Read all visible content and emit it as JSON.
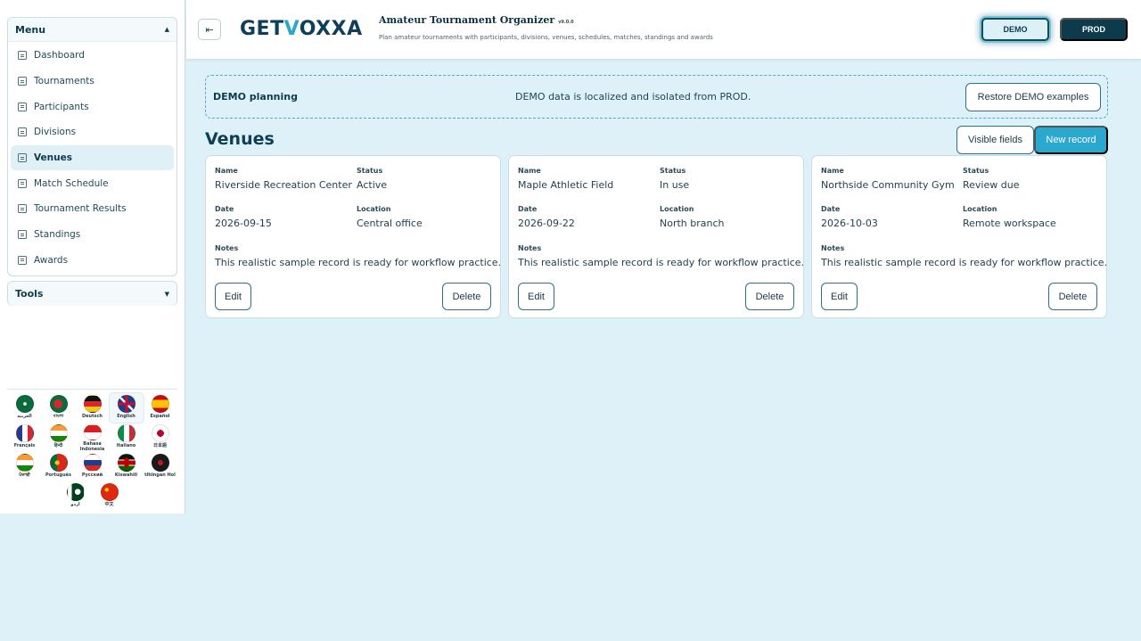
{
  "sidebar": {
    "menu_title": "Menu",
    "tools_title": "Tools",
    "items": [
      {
        "label": "Dashboard"
      },
      {
        "label": "Tournaments"
      },
      {
        "label": "Participants"
      },
      {
        "label": "Divisions"
      },
      {
        "label": "Venues",
        "active": true
      },
      {
        "label": "Match Schedule"
      },
      {
        "label": "Tournament Results"
      },
      {
        "label": "Standings"
      },
      {
        "label": "Awards"
      }
    ],
    "languages": [
      {
        "label": "العربية",
        "flag": "saudi-arabia-flag-icon"
      },
      {
        "label": "বাংলা",
        "flag": "bangladesh-flag-icon"
      },
      {
        "label": "Deutsch",
        "flag": "germany-flag-icon"
      },
      {
        "label": "English",
        "flag": "uk-flag-icon",
        "active": true
      },
      {
        "label": "Español",
        "flag": "spain-flag-icon"
      },
      {
        "label": "Français",
        "flag": "france-flag-icon"
      },
      {
        "label": "हिन्दी",
        "flag": "india-flag-icon"
      },
      {
        "label": "Bahasa Indonesia",
        "flag": "indonesia-flag-icon"
      },
      {
        "label": "Italiano",
        "flag": "italy-flag-icon"
      },
      {
        "label": "日本語",
        "flag": "japan-flag-icon"
      },
      {
        "label": "ਪੰਜਾਬੀ",
        "flag": "india-flag-icon"
      },
      {
        "label": "Português",
        "flag": "portugal-flag-icon"
      },
      {
        "label": "Русский",
        "flag": "russia-flag-icon"
      },
      {
        "label": "Kiswahili",
        "flag": "kenya-flag-icon"
      },
      {
        "label": "tlhIngan Hol",
        "flag": "klingon-flag-icon"
      },
      {
        "label": "اردو",
        "flag": "pakistan-flag-icon"
      },
      {
        "label": "中文",
        "flag": "china-flag-icon"
      }
    ]
  },
  "header": {
    "logo_left": "GET",
    "logo_check": "V",
    "logo_right": "OXXA",
    "title": "Amateur Tournament Organizer",
    "version": "v9.0.0",
    "subtitle": "Plan amateur tournaments with participants, divisions, venues, schedules, matches, standings and awards",
    "demo_label": "DEMO",
    "prod_label": "PROD",
    "toggle_glyph": "⇤"
  },
  "banner": {
    "label": "DEMO planning",
    "text": "DEMO data is localized and isolated from PROD.",
    "restore_label": "Restore DEMO examples"
  },
  "main": {
    "title": "Venues",
    "visible_fields_label": "Visible fields",
    "new_record_label": "New record",
    "field_labels": {
      "name": "Name",
      "status": "Status",
      "date": "Date",
      "location": "Location",
      "notes": "Notes"
    },
    "edit_label": "Edit",
    "delete_label": "Delete",
    "records": [
      {
        "name": "Riverside Recreation Center",
        "status": "Active",
        "date": "2026-09-15",
        "location": "Central office",
        "notes": "This realistic sample record is ready for workflow practice."
      },
      {
        "name": "Maple Athletic Field",
        "status": "In use",
        "date": "2026-09-22",
        "location": "North branch",
        "notes": "This realistic sample record is ready for workflow practice."
      },
      {
        "name": "Northside Community Gym",
        "status": "Review due",
        "date": "2026-10-03",
        "location": "Remote workspace",
        "notes": "This realistic sample record is ready for workflow practice."
      }
    ]
  },
  "colors": {
    "accent": "#2ba8d0",
    "brand_dark": "#0d3b4c",
    "background": "#dff1f8"
  }
}
